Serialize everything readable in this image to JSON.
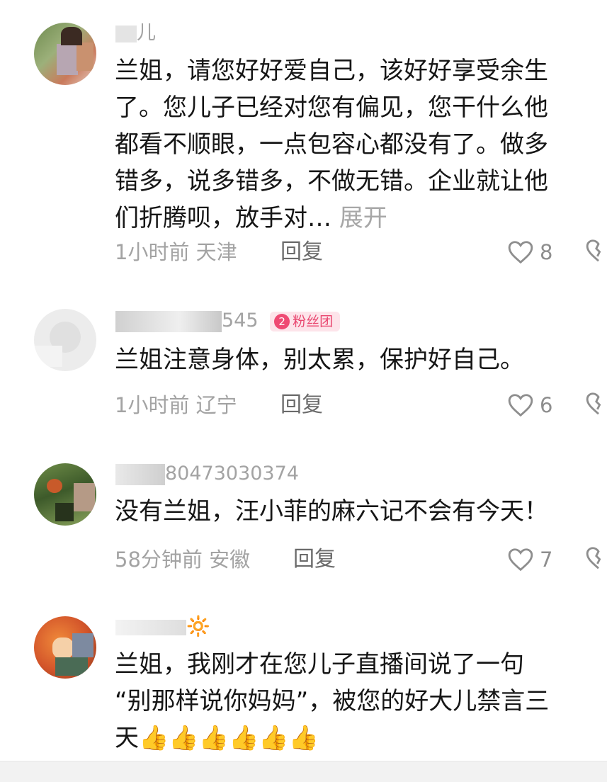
{
  "comments": [
    {
      "username_visible": "儿",
      "text_lines": [
        "兰姐，请您好好爱自己，该好好享受余生",
        "了。您儿子已经对您有偏见，您干什么他",
        "都看不顺眼，一点包容心都没有了。做多",
        "错多，说多错多，不做无错。企业就让他",
        "们折腾呗，放手对…"
      ],
      "expand_label": "展开",
      "time": "1小时前",
      "location": "天津",
      "reply_label": "回复",
      "likes": "8"
    },
    {
      "username_visible": "545",
      "fans_badge_level": "2",
      "fans_badge_label": "粉丝团",
      "text_lines": [
        "兰姐注意身体，别太累，保护好自己。"
      ],
      "time": "1小时前",
      "location": "辽宁",
      "reply_label": "回复",
      "likes": "6"
    },
    {
      "username_visible": "80473030374",
      "text_lines": [
        "没有兰姐，汪小菲的麻六记不会有今天！"
      ],
      "time": "58分钟前",
      "location": "安徽",
      "reply_label": "回复",
      "likes": "7"
    },
    {
      "username_visible": "🔆",
      "text_lines": [
        "兰姐，我刚才在您儿子直播间说了一句",
        "“别那样说你妈妈”，被您的好大儿禁言三",
        "天👍👍👍👍👍👍"
      ]
    }
  ],
  "colors": {
    "text": "#161616",
    "meta": "#a3a3a3",
    "badge_bg": "#fde4ea",
    "badge_fg": "#e94870"
  },
  "icons": [
    "heart-outline-icon",
    "broken-heart-icon",
    "sun-icon",
    "thumbs-up-emoji"
  ]
}
